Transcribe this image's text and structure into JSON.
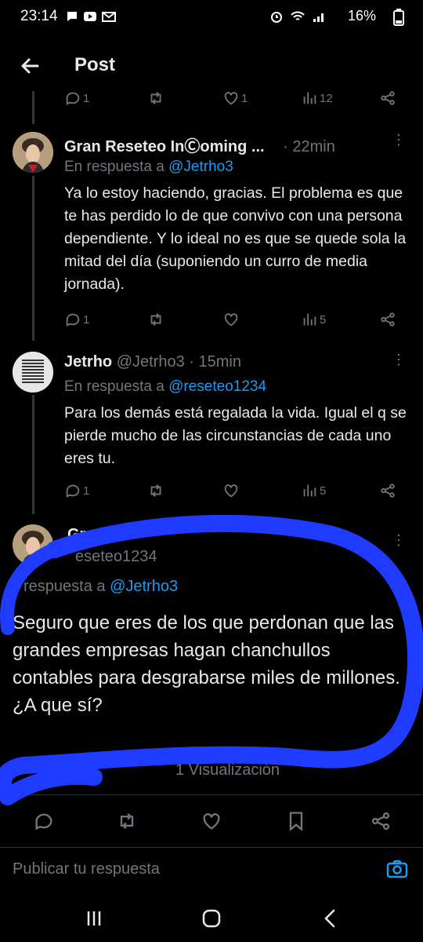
{
  "status_bar": {
    "time": "23:14",
    "battery": "16%"
  },
  "header": {
    "title": "Post"
  },
  "top_actions": {
    "replies": "1",
    "likes": "1",
    "views": "12"
  },
  "tweets": [
    {
      "name": "Gran Reseteo InⒸoming ...",
      "handle": "",
      "time": "· 22min",
      "reply_prefix": "En respuesta a ",
      "reply_to": "@Jetrho3",
      "body": "Ya lo estoy haciendo, gracias. El problema es que te has perdido lo de que convivo con una persona dependiente. Y lo ideal no es que se quede sola la mitad del día (suponiendo un curro de media jornada).",
      "replies": "1",
      "views": "5"
    },
    {
      "name": "Jetrho",
      "handle": "@Jetrho3",
      "time": "· 15min",
      "reply_prefix": "En respuesta a ",
      "reply_to": "@reseteo1234",
      "body": "Para los demás está regalada la vida. Igual el q se pierde mucho de las circunstancias de cada uno eres tu.",
      "replies": "1",
      "views": "5"
    }
  ],
  "main_tweet": {
    "name": "Gran",
    "handle": "eseteo1234",
    "reply_prefix": "respuesta a ",
    "reply_to": "@Jetrho3",
    "body": "Seguro que eres de los que perdonan que las grandes empresas hagan chanchullos contables para desgrabarse miles de millones. ¿A que sí?",
    "meta": "1 Visualización"
  },
  "reply_bar": {
    "placeholder": "Publicar tu respuesta"
  },
  "colors": {
    "background": "#000000",
    "accent": "#1d9bf0",
    "muted": "#71767b",
    "scribble": "#1f3bff"
  }
}
